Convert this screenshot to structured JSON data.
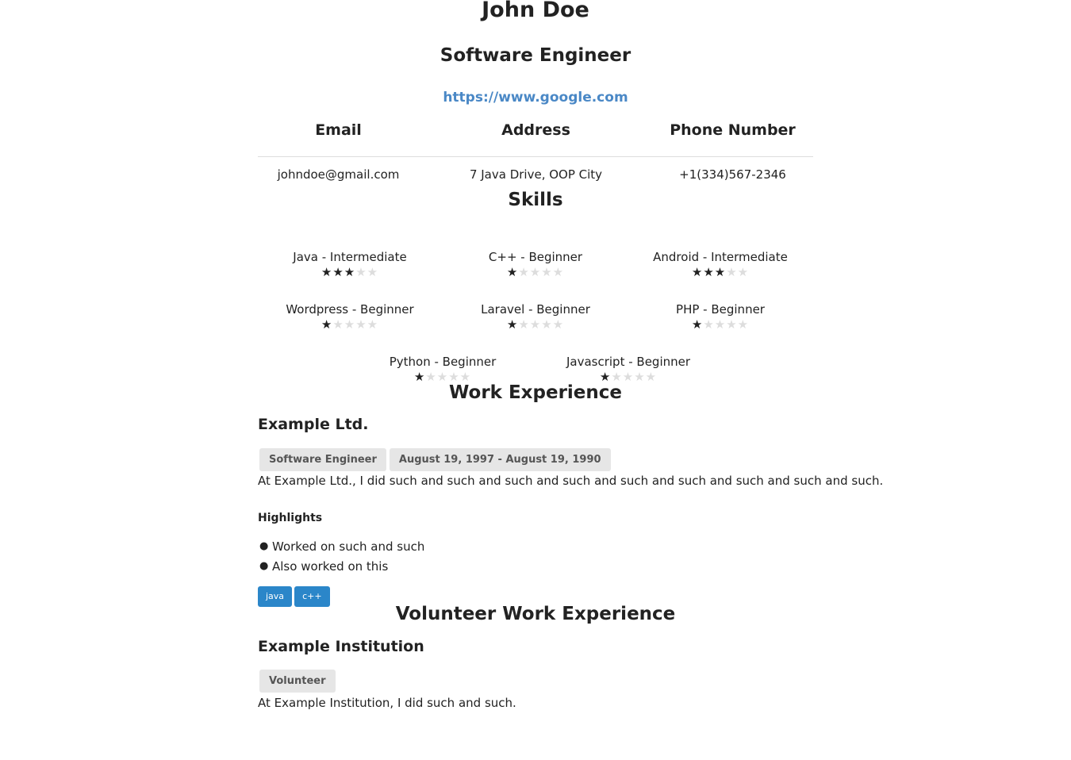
{
  "header": {
    "name": "John Doe",
    "role": "Software Engineer",
    "website": "https://www.google.com"
  },
  "contact": {
    "headers": [
      "Email",
      "Address",
      "Phone Number"
    ],
    "values": [
      "johndoe@gmail.com",
      "7 Java Drive, OOP City",
      "+1(334)567-2346"
    ]
  },
  "skills": {
    "title": "Skills",
    "max_rating": 5,
    "items": [
      {
        "label": "Java - Intermediate",
        "rating": 3
      },
      {
        "label": "C++ - Beginner",
        "rating": 1
      },
      {
        "label": "Android - Intermediate",
        "rating": 3
      },
      {
        "label": "Wordpress - Beginner",
        "rating": 1
      },
      {
        "label": "Laravel - Beginner",
        "rating": 1
      },
      {
        "label": "PHP - Beginner",
        "rating": 1
      },
      {
        "label": "Python - Beginner",
        "rating": 1
      },
      {
        "label": "Javascript - Beginner",
        "rating": 1
      }
    ]
  },
  "work": {
    "title": "Work Experience",
    "company": "Example Ltd.",
    "position": "Software Engineer",
    "dates": "August 19, 1997 - August 19, 1990",
    "summary": "At Example Ltd., I did such and such and such and such and such and such and such and such and such.",
    "highlights_title": "Highlights",
    "highlights": [
      "Worked on such and such",
      "Also worked on this"
    ],
    "keywords": [
      "java",
      "c++"
    ]
  },
  "volunteer": {
    "title": "Volunteer Work Experience",
    "organization": "Example Institution",
    "position": "Volunteer",
    "summary": "At Example Institution, I did such and such."
  },
  "colors": {
    "link": "#4a88c6",
    "keyword_badge": "#2b86c9",
    "tag_bg": "#e6e6e6",
    "star_on": "#222222",
    "star_off": "#dddddd"
  },
  "icons": {
    "star": "star-icon",
    "bullet": "bullet-icon"
  }
}
